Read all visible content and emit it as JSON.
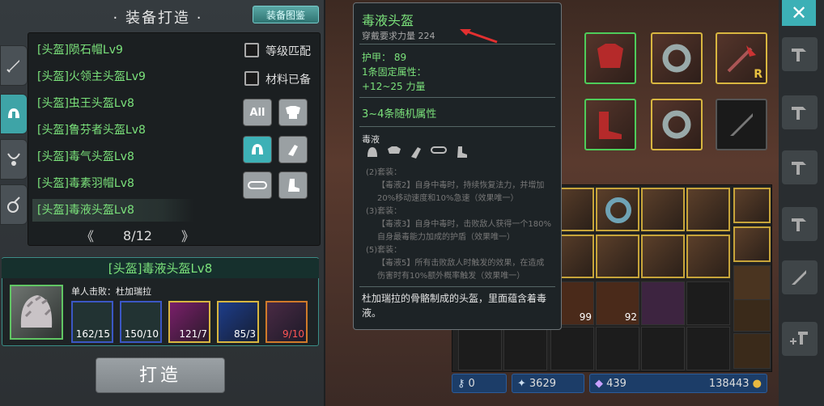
{
  "left": {
    "title": "装备打造",
    "atlas_button": "装备图鉴",
    "list": [
      "[头盔]陨石帽Lv9",
      "[头盔]火领主头盔Lv9",
      "[头盔]虫王头盔Lv8",
      "[头盔]鲁芬者头盔Lv8",
      "[头盔]毒气头盔Lv8",
      "[头盔]毒素羽帽Lv8",
      "[头盔]毒液头盔Lv8"
    ],
    "selected_index": 6,
    "checkbox_level": "等级匹配",
    "checkbox_material": "材料已备",
    "filter_all": "All",
    "page": "8/12",
    "detail_title": "[头盔]毒液头盔Lv8",
    "drop_label": "单人击败：杜加瑞拉",
    "materials": [
      "162/15",
      "150/10",
      "121/7",
      "85/3",
      "9/10"
    ],
    "craft_button": "打造"
  },
  "tooltip": {
    "name": "毒液头盔",
    "requirement": "穿戴要求力量 224",
    "armor": "护甲：  89",
    "fixed_attr": "1条固定属性：",
    "strength": "+12~25 力量",
    "random_attr": "3~4条随机属性",
    "set_name": "毒液",
    "set2_head": "(2)套装：",
    "set2_text": "【毒液2】自身中毒时，持续恢复法力，并增加20%移动速度和10%急速（效果唯一）",
    "set3_head": "(3)套装：",
    "set3_text": "【毒液3】自身中毒时，击败敌人获得一个180%自身最毒能力加成的护盾（效果唯一）",
    "set5_head": "(5)套装：",
    "set5_text": "【毒液5】所有击败敌人时触发的效果，在造成伤害时有10%额外概率触发（效果唯一）",
    "description": "杜加瑞拉的骨骼制成的头盔，里面蕴含着毒液。"
  },
  "inventory": {
    "counts": [
      "99",
      "92"
    ]
  },
  "status": {
    "keys": "0",
    "gems": "3629",
    "crystals": "439",
    "gold": "138443"
  },
  "close_label": "✕",
  "equip_badge": "R"
}
